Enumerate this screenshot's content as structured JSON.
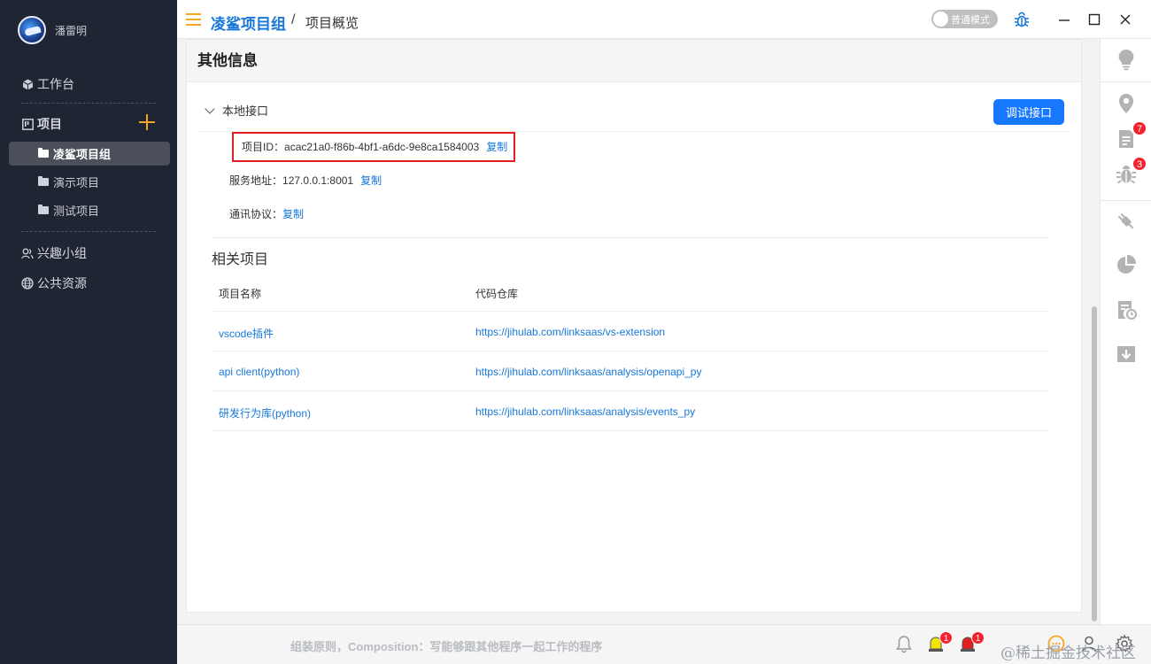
{
  "sidebar": {
    "user_name": "潘雷明",
    "workbench": "工作台",
    "projects_label": "项目",
    "projects": [
      {
        "label": "凌鲨项目组",
        "active": true
      },
      {
        "label": "演示项目",
        "active": false
      },
      {
        "label": "测试项目",
        "active": false
      }
    ],
    "interest_group": "兴趣小组",
    "public_resources": "公共资源"
  },
  "header": {
    "breadcrumb_main": "凌鲨项目组",
    "breadcrumb_sep": "/",
    "breadcrumb_sub": "项目概览",
    "mode_label": "普通模式"
  },
  "panel": {
    "title": "其他信息",
    "local_api_label": "本地接口",
    "debug_button": "调试接口",
    "project_id_label": "项目ID：",
    "project_id": "acac21a0-f86b-4bf1-a6dc-9e8ca1584003",
    "service_addr_label": "服务地址：",
    "service_addr": "127.0.0.1:8001",
    "protocol_label": "通讯协议：",
    "copy": "复制",
    "related_title": "相关项目",
    "table_headers": [
      "项目名称",
      "代码仓库"
    ],
    "rows": [
      {
        "name": "vscode插件",
        "repo": "https://jihulab.com/linksaas/vs-extension"
      },
      {
        "name": "api client(python)",
        "repo": "https://jihulab.com/linksaas/analysis/openapi_py"
      },
      {
        "name": "研发行为库(python)",
        "repo": "https://jihulab.com/linksaas/analysis/events_py"
      }
    ]
  },
  "rightbar": {
    "badges": {
      "docs": "7",
      "bugs": "3"
    }
  },
  "statusbar": {
    "motto": "组装原则，Composition：写能够跟其他程序一起工作的程序",
    "badge_alarm": "1",
    "badge_siren": "1",
    "watermark": "@稀土掘金技术社区"
  },
  "colors": {
    "accent": "#1677ff",
    "brand_orange": "#f6a623",
    "sidebar_bg": "#1f2532",
    "highlight": "#e02020"
  }
}
